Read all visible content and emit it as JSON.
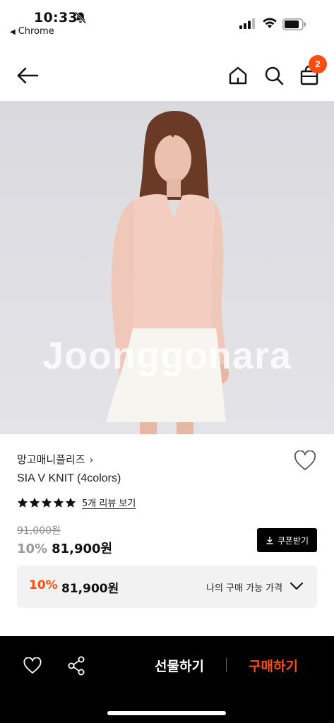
{
  "status_bar": {
    "time": "10:33",
    "back_app": "Chrome",
    "icons": [
      "bell-off-icon",
      "signal-icon",
      "wifi-icon",
      "battery-icon"
    ]
  },
  "nav": {
    "icons": [
      "back-arrow-icon",
      "home-icon",
      "search-icon",
      "shopping-bag-icon"
    ],
    "cart_count": "2"
  },
  "product_image": {
    "watermark": "Joonggonara"
  },
  "product": {
    "brand": "망고매니플리즈",
    "brand_chevron": "›",
    "name": "SIA V KNIT (4colors)",
    "rating_stars": 5,
    "review_link": "5개 리뷰 보기",
    "original_price": "91,000원",
    "discount": "10%",
    "price": "81,900원",
    "coupon_button": "쿠폰받기"
  },
  "my_price": {
    "discount": "10%",
    "price": "81,900원",
    "label": "나의 구매 가능 가격"
  },
  "bottom_bar": {
    "gift_button": "선물하기",
    "buy_button": "구매하기"
  },
  "colors": {
    "accent": "#ff4d12",
    "bottom_bar_bg": "#000000",
    "price_box_bg": "#f2f2f2"
  }
}
